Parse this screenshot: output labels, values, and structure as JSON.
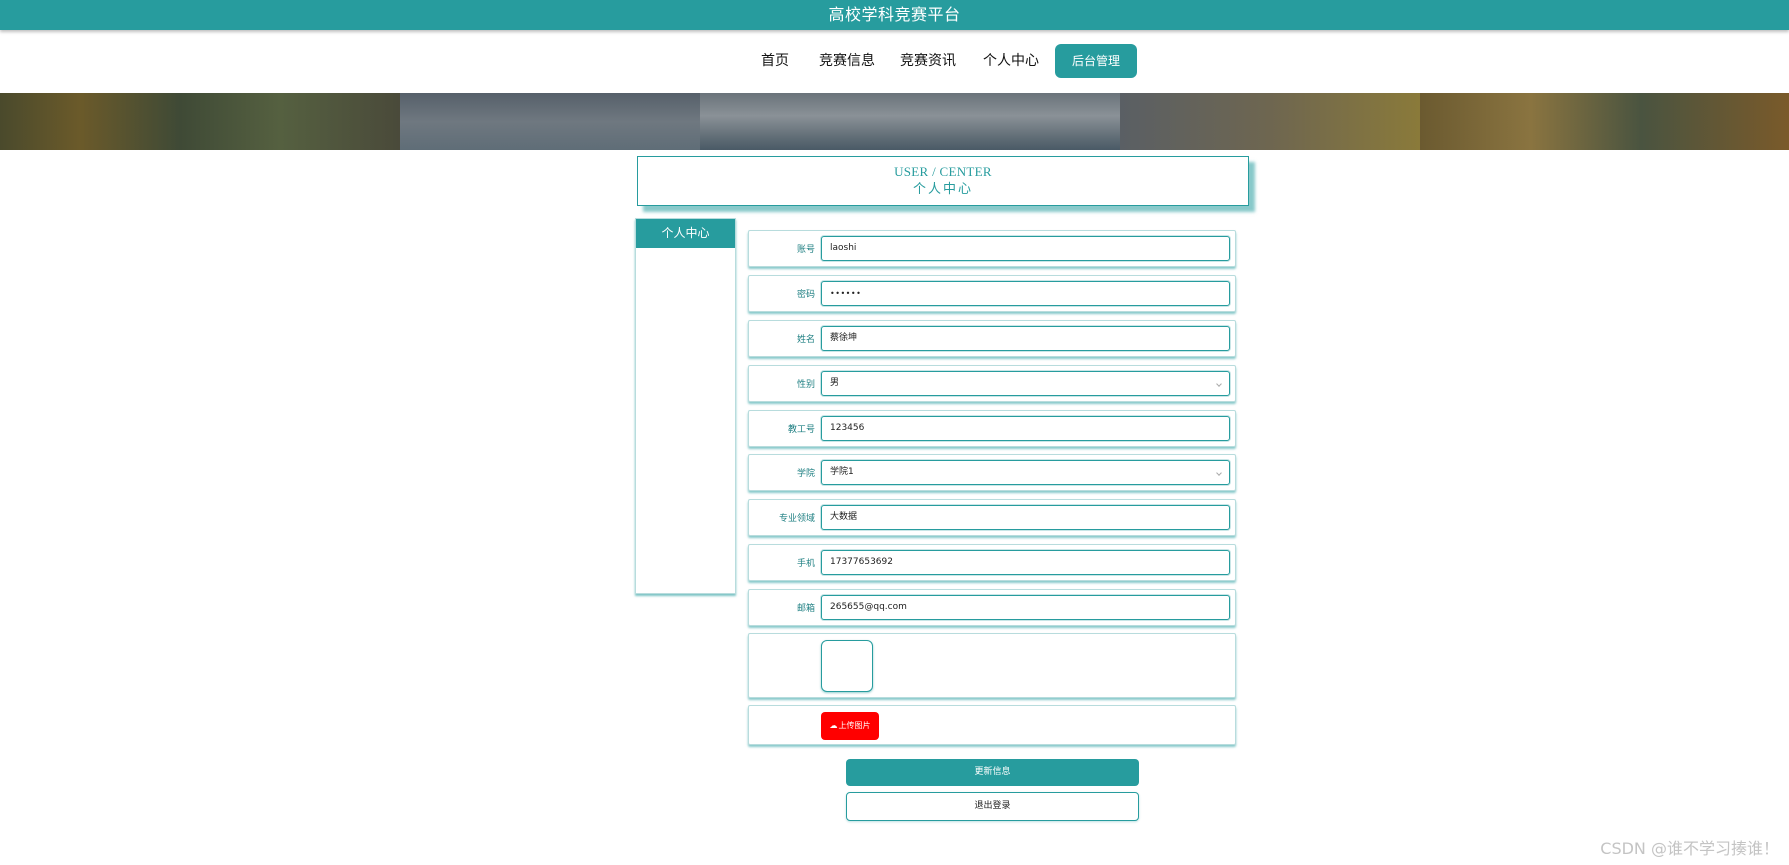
{
  "header": {
    "title": "高校学科竞赛平台"
  },
  "nav": {
    "items": [
      "首页",
      "竞赛信息",
      "竞赛资讯",
      "个人中心"
    ],
    "admin_label": "后台管理"
  },
  "user_center": {
    "title_en": "USER / CENTER",
    "title_cn": "个人中心"
  },
  "sidebar": {
    "head_label": "个人中心"
  },
  "form": {
    "account_label": "账号",
    "account_value": "laoshi",
    "password_label": "密码",
    "password_value": "••••••",
    "name_label": "姓名",
    "name_value": "蔡徐坤",
    "gender_label": "性别",
    "gender_value": "男",
    "staff_no_label": "教工号",
    "staff_no_value": "123456",
    "college_label": "学院",
    "college_value": "学院1",
    "field_label": "专业领域",
    "field_value": "大数据",
    "phone_label": "手机",
    "phone_value": "17377653692",
    "email_label": "邮箱",
    "email_value": "265655@qq.com",
    "upload_label": "上传图片"
  },
  "buttons": {
    "update": "更新信息",
    "logout": "退出登录"
  },
  "watermark": "CSDN @谁不学习揍谁！",
  "colors": {
    "accent": "#279c9e",
    "upload": "#ff0000"
  }
}
